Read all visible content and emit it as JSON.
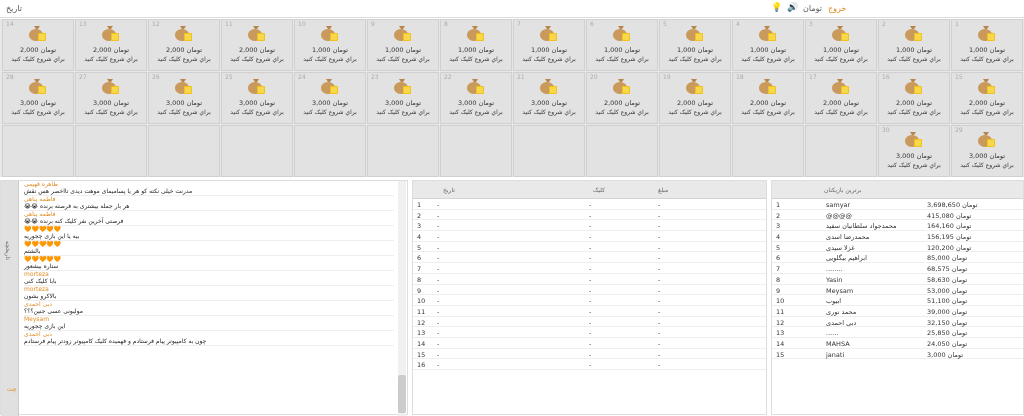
{
  "topbar": {
    "left_label": "تاریخ",
    "user_name": "تومان",
    "exit_label": "خروج"
  },
  "prizes": [
    {
      "num": "1",
      "amount": "تومان 1,000",
      "hint": "براي شروع كليک كنيد"
    },
    {
      "num": "2",
      "amount": "تومان 1,000",
      "hint": "براي شروع كليک كنيد"
    },
    {
      "num": "3",
      "amount": "تومان 1,000",
      "hint": "براي شروع كليک كنيد"
    },
    {
      "num": "4",
      "amount": "تومان 1,000",
      "hint": "براي شروع كليک كنيد"
    },
    {
      "num": "5",
      "amount": "تومان 1,000",
      "hint": "براي شروع كليک كنيد"
    },
    {
      "num": "6",
      "amount": "تومان 1,000",
      "hint": "براي شروع كليک كنيد"
    },
    {
      "num": "7",
      "amount": "تومان 1,000",
      "hint": "براي شروع كليک كنيد"
    },
    {
      "num": "8",
      "amount": "تومان 1,000",
      "hint": "براي شروع كليک كنيد"
    },
    {
      "num": "9",
      "amount": "تومان 1,000",
      "hint": "براي شروع كليک كنيد"
    },
    {
      "num": "10",
      "amount": "تومان 1,000",
      "hint": "براي شروع كليک كنيد"
    },
    {
      "num": "11",
      "amount": "تومان 2,000",
      "hint": "براي شروع كليک كنيد"
    },
    {
      "num": "12",
      "amount": "تومان 2,000",
      "hint": "براي شروع كليک كنيد"
    },
    {
      "num": "13",
      "amount": "تومان 2,000",
      "hint": "براي شروع كليک كنيد"
    },
    {
      "num": "14",
      "amount": "تومان 2,000",
      "hint": "براي شروع كليک كنيد"
    },
    {
      "num": "15",
      "amount": "تومان 2,000",
      "hint": "براي شروع كليک كنيد"
    },
    {
      "num": "16",
      "amount": "تومان 2,000",
      "hint": "براي شروع كليک كنيد"
    },
    {
      "num": "17",
      "amount": "تومان 2,000",
      "hint": "براي شروع كليک كنيد"
    },
    {
      "num": "18",
      "amount": "تومان 2,000",
      "hint": "براي شروع كليک كنيد"
    },
    {
      "num": "19",
      "amount": "تومان 2,000",
      "hint": "براي شروع كليک كنيد"
    },
    {
      "num": "20",
      "amount": "تومان 2,000",
      "hint": "براي شروع كليک كنيد"
    },
    {
      "num": "21",
      "amount": "تومان 3,000",
      "hint": "براي شروع كليک كنيد"
    },
    {
      "num": "22",
      "amount": "تومان 3,000",
      "hint": "براي شروع كليک كنيد"
    },
    {
      "num": "23",
      "amount": "تومان 3,000",
      "hint": "براي شروع كليک كنيد"
    },
    {
      "num": "24",
      "amount": "تومان 3,000",
      "hint": "براي شروع كليک كنيد"
    },
    {
      "num": "25",
      "amount": "تومان 3,000",
      "hint": "براي شروع كليک كنيد"
    },
    {
      "num": "26",
      "amount": "تومان 3,000",
      "hint": "براي شروع كليک كنيد"
    },
    {
      "num": "27",
      "amount": "تومان 3,000",
      "hint": "براي شروع كليک كنيد"
    },
    {
      "num": "28",
      "amount": "تومان 3,000",
      "hint": "براي شروع كليک كنيد"
    },
    {
      "num": "29",
      "amount": "تومان 3,000",
      "hint": "براي شروع كليک كنيد"
    },
    {
      "num": "30",
      "amount": "تومان 3,000",
      "hint": "براي شروع كليک كنيد"
    }
  ],
  "chat": {
    "tab_label": "تاریخچه",
    "tab_bottom": "چت",
    "messages": [
      {
        "name": "طاهره فهیمی",
        "text": "مدرنت خیلی نکته کو هر یا پسامیمای موهت دیدی تااخصر هس نقش"
      },
      {
        "name": "فاطمه پناهی",
        "text": "😭😭 هر بار جمله بیشتری به فرصته برنده"
      },
      {
        "name": "فاطمه پناهی",
        "text": "😭😭 فرصتی آخرین نفر کلیک کنه برنده"
      },
      {
        "name": "🧡🧡🧡🧡🧡",
        "text": "بیه یا این بازی چجوریه"
      },
      {
        "name": "🧡🧡🧡🧡🧡",
        "text": "بالشتم"
      },
      {
        "name": "🧡🧡🧡🧡🧡",
        "text": "ستاره بیشعور"
      },
      {
        "name": "morteza",
        "text": "بابا کلیک کنی"
      },
      {
        "name": "morteza",
        "text": "بالاکرو بشون"
      },
      {
        "name": "دبی احمدی",
        "text": "مولیونی عسی جنین؟؟؟"
      },
      {
        "name": "Meysam",
        "text": "این بازی چجوریه"
      },
      {
        "name": "دبی احمدی",
        "text": "چون به کامپیوتر پیام فرستادم و فهمیده کلیک کامپیوتر زودتر پیام فرستادم"
      }
    ]
  },
  "mid": {
    "headers": {
      "c1": "تاریخ",
      "c2": "کلیک",
      "c3": "مبلغ"
    },
    "rows": [
      {
        "n": "1",
        "a": "-",
        "b": "-",
        "c": "-"
      },
      {
        "n": "2",
        "a": "-",
        "b": "-",
        "c": "-"
      },
      {
        "n": "3",
        "a": "-",
        "b": "-",
        "c": "-"
      },
      {
        "n": "4",
        "a": "-",
        "b": "-",
        "c": "-"
      },
      {
        "n": "5",
        "a": "-",
        "b": "-",
        "c": "-"
      },
      {
        "n": "6",
        "a": "-",
        "b": "-",
        "c": "-"
      },
      {
        "n": "7",
        "a": "-",
        "b": "-",
        "c": "-"
      },
      {
        "n": "8",
        "a": "-",
        "b": "-",
        "c": "-"
      },
      {
        "n": "9",
        "a": "-",
        "b": "-",
        "c": "-"
      },
      {
        "n": "10",
        "a": "-",
        "b": "-",
        "c": "-"
      },
      {
        "n": "11",
        "a": "-",
        "b": "-",
        "c": "-"
      },
      {
        "n": "12",
        "a": "-",
        "b": "-",
        "c": "-"
      },
      {
        "n": "13",
        "a": "-",
        "b": "-",
        "c": "-"
      },
      {
        "n": "14",
        "a": "-",
        "b": "-",
        "c": "-"
      },
      {
        "n": "15",
        "a": "-",
        "b": "-",
        "c": "-"
      },
      {
        "n": "16",
        "a": "-",
        "b": "-",
        "c": "-"
      }
    ]
  },
  "leaders": {
    "header": "برترین بازیکنان",
    "rows": [
      {
        "n": "1",
        "name": "samyar",
        "amount": "تومان 3,698,650"
      },
      {
        "n": "2",
        "name": "@@@@",
        "amount": "تومان 415,080"
      },
      {
        "n": "3",
        "name": "محمدجواد سلطانیان سفید",
        "amount": "تومان 164,160"
      },
      {
        "n": "4",
        "name": "محمدرضا اسدی",
        "amount": "تومان 156,195"
      },
      {
        "n": "5",
        "name": "غزلا سیدی",
        "amount": "تومان 120,200"
      },
      {
        "n": "6",
        "name": "ابراهیم بیگلویی",
        "amount": "تومان 85,000"
      },
      {
        "n": "7",
        "name": "........",
        "amount": "تومان 68,575"
      },
      {
        "n": "8",
        "name": "Yasin",
        "amount": "تومان 58,630"
      },
      {
        "n": "9",
        "name": "Meysam",
        "amount": "تومان 53,000"
      },
      {
        "n": "10",
        "name": "ابیوب",
        "amount": "تومان 51,100"
      },
      {
        "n": "11",
        "name": "محمد نوری",
        "amount": "تومان 39,000"
      },
      {
        "n": "12",
        "name": "دبی احمدی",
        "amount": "تومان 32,150"
      },
      {
        "n": "13",
        "name": "......",
        "amount": "تومان 25,850"
      },
      {
        "n": "14",
        "name": "MAHSA",
        "amount": "تومان 24,050"
      },
      {
        "n": "15",
        "name": "janati",
        "amount": "تومان 3,000"
      }
    ]
  }
}
